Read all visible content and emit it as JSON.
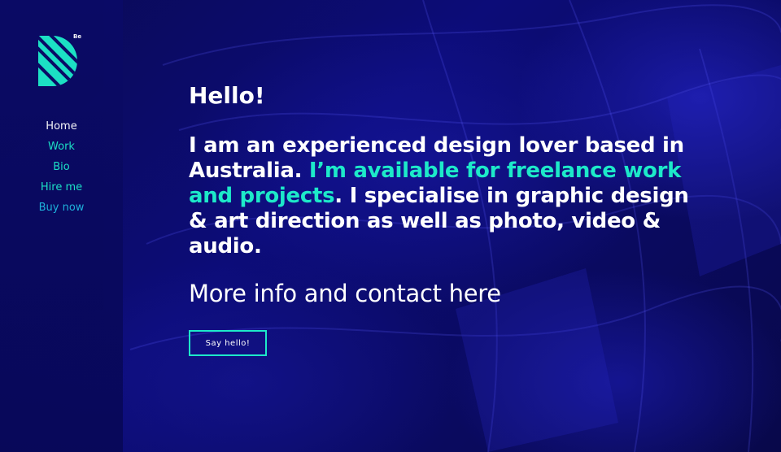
{
  "logo": {
    "badge": "Be"
  },
  "nav": {
    "items": [
      {
        "label": "Home"
      },
      {
        "label": "Work"
      },
      {
        "label": "Bio"
      },
      {
        "label": "Hire me"
      },
      {
        "label": "Buy now"
      }
    ]
  },
  "main": {
    "greeting": "Hello!",
    "intro_part1": "I am an experienced design lover based in Australia. ",
    "intro_accent": "I’m available for freelance work and projects",
    "intro_part2": ". I specialise in graphic design & art direction as well as photo, video & audio.",
    "more_info": "More info and contact here",
    "cta_label": "Say hello!"
  },
  "colors": {
    "accent": "#1de9c9",
    "background": "#0a0a60",
    "sidebar": "#0a0a66",
    "text": "#ffffff"
  }
}
